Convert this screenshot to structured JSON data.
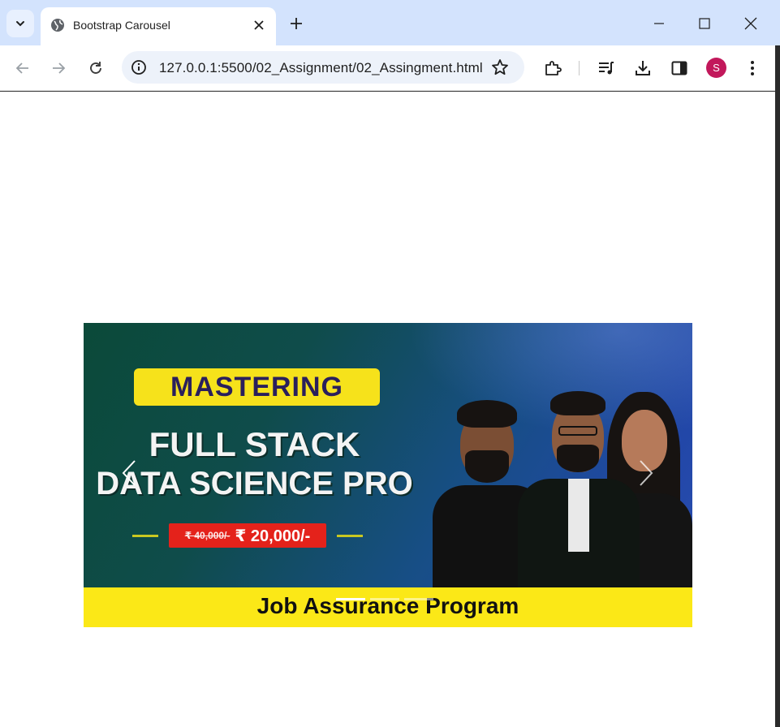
{
  "browser": {
    "tab_title": "Bootstrap Carousel",
    "url": "127.0.0.1:5500/02_Assignment/02_Assingment.html",
    "profile_initial": "S"
  },
  "carousel": {
    "badge_text": "MASTERING",
    "headline_line1": "FULL STACK",
    "headline_line2": "DATA SCIENCE PRO",
    "price_old": "₹ 40,000/-",
    "price_new": "₹ 20,000/-",
    "footer_text": "Job Assurance Program",
    "active_slide_index": 1,
    "slide_count": 3
  },
  "colors": {
    "titlebar": "#d3e3fd",
    "badge_yellow": "#f6e21b",
    "footer_yellow": "#fbe817",
    "price_red": "#e4221b",
    "avatar": "#c2185b"
  }
}
